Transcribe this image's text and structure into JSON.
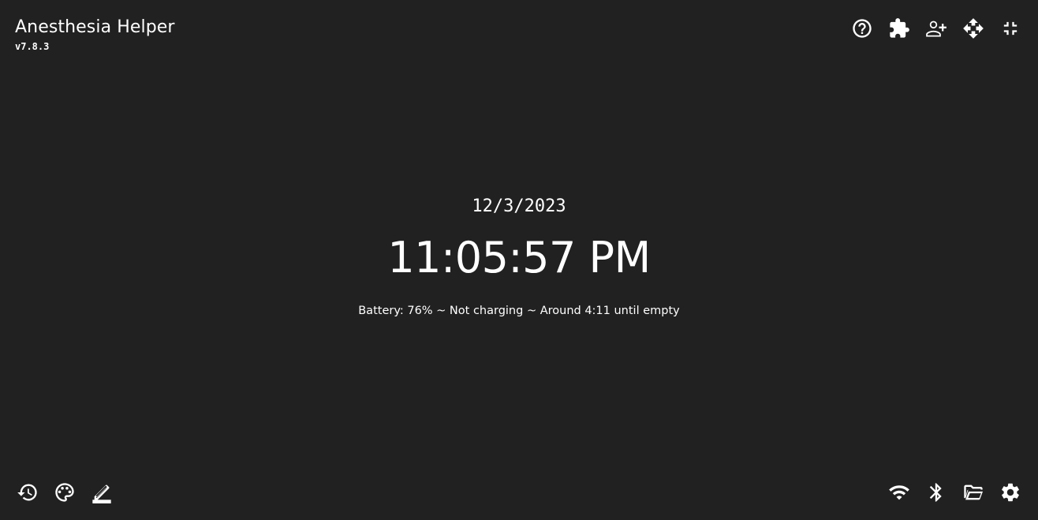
{
  "app": {
    "title": "Anesthesia Helper",
    "version": "v7.8.3"
  },
  "clock": {
    "date": "12/3/2023",
    "time": "11:05:57 PM",
    "battery": "Battery: 76% ~ Not charging ~ Around 4:11 until empty"
  },
  "top_toolbar": [
    "help-icon",
    "puzzle-icon",
    "add-user-icon",
    "move-icon",
    "exit-fullscreen-icon"
  ],
  "bottom_left_toolbar": [
    "history-icon",
    "palette-icon",
    "edit-icon"
  ],
  "bottom_right_toolbar": [
    "wifi-icon",
    "bluetooth-icon",
    "folder-open-icon",
    "gear-icon"
  ],
  "colors": {
    "background": "#212121",
    "foreground": "#ffffff"
  }
}
